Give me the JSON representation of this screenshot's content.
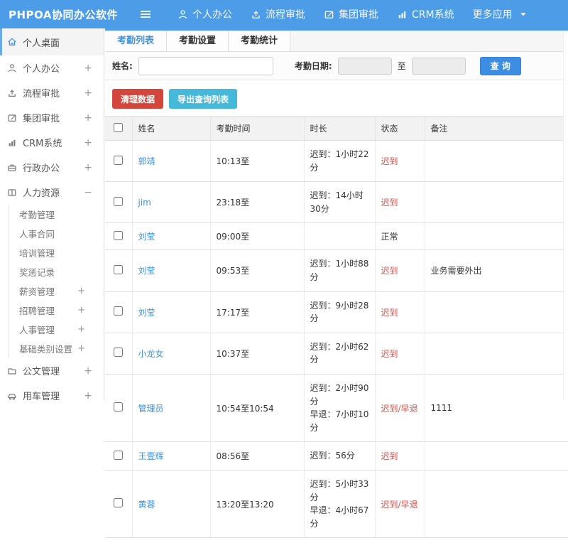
{
  "topbar": {
    "logo": "PHPOA协同办公软件",
    "items": [
      {
        "label": "个人办公",
        "icon": "user",
        "slug": "personal-office"
      },
      {
        "label": "流程审批",
        "icon": "flow",
        "slug": "workflow-approval"
      },
      {
        "label": "集团审批",
        "icon": "edit",
        "slug": "group-approval"
      },
      {
        "label": "CRM系统",
        "icon": "chart",
        "slug": "crm-system"
      },
      {
        "label": "更多应用",
        "icon": "apps",
        "slug": "more-apps",
        "caret": true
      }
    ]
  },
  "sidebar": {
    "items": [
      {
        "label": "个人桌面",
        "icon": "home",
        "slug": "personal-desktop",
        "active": true
      },
      {
        "label": "个人办公",
        "icon": "user",
        "slug": "personal-office",
        "toggle": "+"
      },
      {
        "label": "流程审批",
        "icon": "flow",
        "slug": "workflow-approval",
        "toggle": "+"
      },
      {
        "label": "集团审批",
        "icon": "edit",
        "slug": "group-approval",
        "toggle": "+"
      },
      {
        "label": "CRM系统",
        "icon": "chart",
        "slug": "crm-system",
        "toggle": "+"
      },
      {
        "label": "行政办公",
        "icon": "briefcase",
        "slug": "admin-office",
        "toggle": "+"
      },
      {
        "label": "人力资源",
        "icon": "book",
        "slug": "human-resources",
        "toggle": "−",
        "expanded": true,
        "children": [
          {
            "label": "考勤管理",
            "slug": "attendance-management"
          },
          {
            "label": "人事合同",
            "slug": "hr-contract"
          },
          {
            "label": "培训管理",
            "slug": "training-management"
          },
          {
            "label": "奖惩记录",
            "slug": "reward-punishment-records"
          },
          {
            "label": "薪资管理",
            "slug": "salary-management",
            "toggle": "+"
          },
          {
            "label": "招聘管理",
            "slug": "recruitment-management",
            "toggle": "+"
          },
          {
            "label": "人事管理",
            "slug": "personnel-management",
            "toggle": "+"
          },
          {
            "label": "基础类别设置",
            "slug": "base-category-settings",
            "toggle": "+"
          }
        ]
      },
      {
        "label": "公文管理",
        "icon": "doc",
        "slug": "document-management",
        "toggle": "+"
      },
      {
        "label": "用车管理",
        "icon": "car",
        "slug": "vehicle-management",
        "toggle": "+"
      }
    ]
  },
  "tabs": [
    {
      "label": "考勤列表",
      "slug": "attendance-list",
      "active": true
    },
    {
      "label": "考勤设置",
      "slug": "attendance-settings",
      "active": false
    },
    {
      "label": "考勤统计",
      "slug": "attendance-stats",
      "active": false
    }
  ],
  "filter": {
    "name_label": "姓名:",
    "name_value": "",
    "date_label": "考勤日期:",
    "date_from_value": "",
    "to_label": "至",
    "date_to_value": "",
    "search_button": "查 询"
  },
  "toolbar": {
    "clean_button": "清理数据",
    "export_button": "导出查询列表"
  },
  "table": {
    "columns": [
      "姓名",
      "考勤时间",
      "时长",
      "状态",
      "备注"
    ],
    "rows": [
      {
        "name": "郭靖",
        "time": "10:13至",
        "duration": "迟到：1小时22分",
        "status": "迟到",
        "late": true,
        "note": ""
      },
      {
        "name": "jim",
        "time": "23:18至",
        "duration": "迟到：14小时30分",
        "status": "迟到",
        "late": true,
        "note": ""
      },
      {
        "name": "刘莹",
        "time": "09:00至",
        "duration": "",
        "status": "正常",
        "late": false,
        "note": ""
      },
      {
        "name": "刘莹",
        "time": "09:53至",
        "duration": "迟到：1小时88分",
        "status": "迟到",
        "late": true,
        "note": "业务需要外出"
      },
      {
        "name": "刘莹",
        "time": "17:17至",
        "duration": "迟到：9小时28分",
        "status": "迟到",
        "late": true,
        "note": ""
      },
      {
        "name": "小龙女",
        "time": "10:37至",
        "duration": "迟到：2小时62分",
        "status": "迟到",
        "late": true,
        "note": ""
      },
      {
        "name": "管理员",
        "time": "10:54至10:54",
        "duration": "迟到：2小时90分\n早退：7小时10分",
        "status": "迟到/早退",
        "late": true,
        "note": "1111"
      },
      {
        "name": "王壹辉",
        "time": "08:56至",
        "duration": "迟到：56分",
        "status": "迟到",
        "late": true,
        "note": ""
      },
      {
        "name": "黄蓉",
        "time": "13:20至13:20",
        "duration": "迟到：5小时33分\n早退：4小时67分",
        "status": "迟到/早退",
        "late": true,
        "note": ""
      }
    ]
  },
  "colors": {
    "topbar_bg": "#4d9ce8",
    "accent_blue": "#4193de",
    "danger_red": "#d2463c",
    "export_teal": "#46b8da",
    "status_red": "#d9534f"
  }
}
